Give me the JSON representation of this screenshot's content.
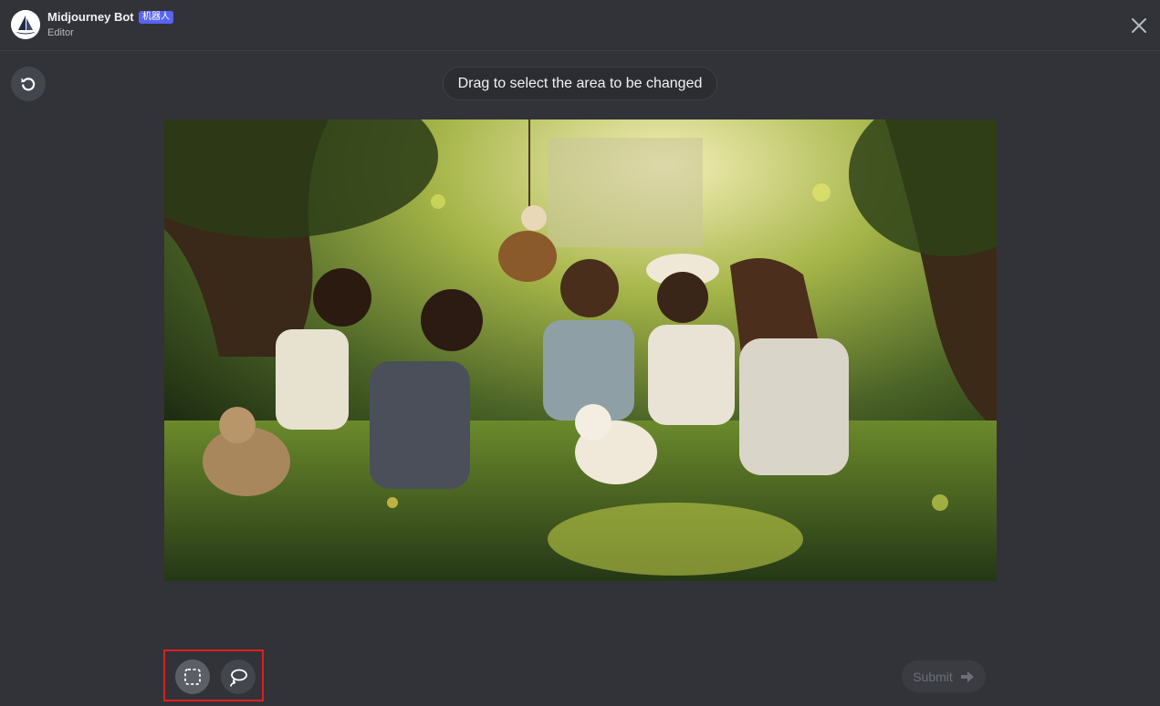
{
  "header": {
    "bot_name": "Midjourney Bot",
    "badge": "机器人",
    "subtitle": "Editor"
  },
  "editor": {
    "hint": "Drag to select the area to be changed",
    "submit_label": "Submit"
  },
  "tools": [
    {
      "name": "rectangle-select",
      "active": true
    },
    {
      "name": "lasso-select",
      "active": false
    }
  ],
  "colors": {
    "background": "#313338",
    "badge": "#5865f2",
    "highlight_box": "#e01e1e"
  }
}
